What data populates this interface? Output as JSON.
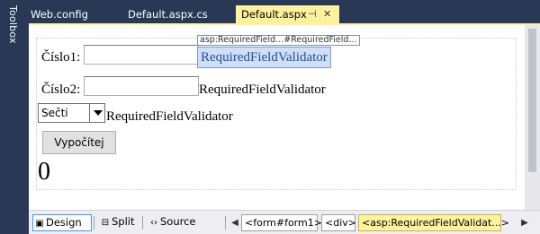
{
  "toolbox": {
    "label": "Toolbox"
  },
  "tabs": [
    {
      "label": "Web.config"
    },
    {
      "label": "Default.aspx.cs"
    },
    {
      "label": "Default.aspx"
    }
  ],
  "tab_icons": {
    "pin": "pin-icon",
    "close": "close-icon",
    "pin_glyph": "⊣",
    "close_glyph": "✕"
  },
  "form": {
    "label1": "Číslo1:",
    "label2": "Číslo2:",
    "tag_tooltip": "asp:RequiredField...#RequiredField...",
    "validator1": "RequiredFieldValidator",
    "validator2": "RequiredFieldValidator",
    "validator3": "RequiredFieldValidator",
    "operation_selected": "Sečti",
    "button_label": "Vypočítej",
    "result": "0"
  },
  "bottombar": {
    "design": "Design",
    "split": "Split",
    "source": "Source",
    "design_icon": "▣",
    "split_icon": "⊟",
    "source_icon": "‹›",
    "nav_left": "◀",
    "nav_right": "▶",
    "crumbs": [
      "<form#form1>",
      "<div>",
      "<asp:RequiredFieldValidat...>"
    ]
  },
  "colors": {
    "accent": "#fff29d",
    "chrome": "#293955",
    "selection": "#cfe0f6"
  }
}
